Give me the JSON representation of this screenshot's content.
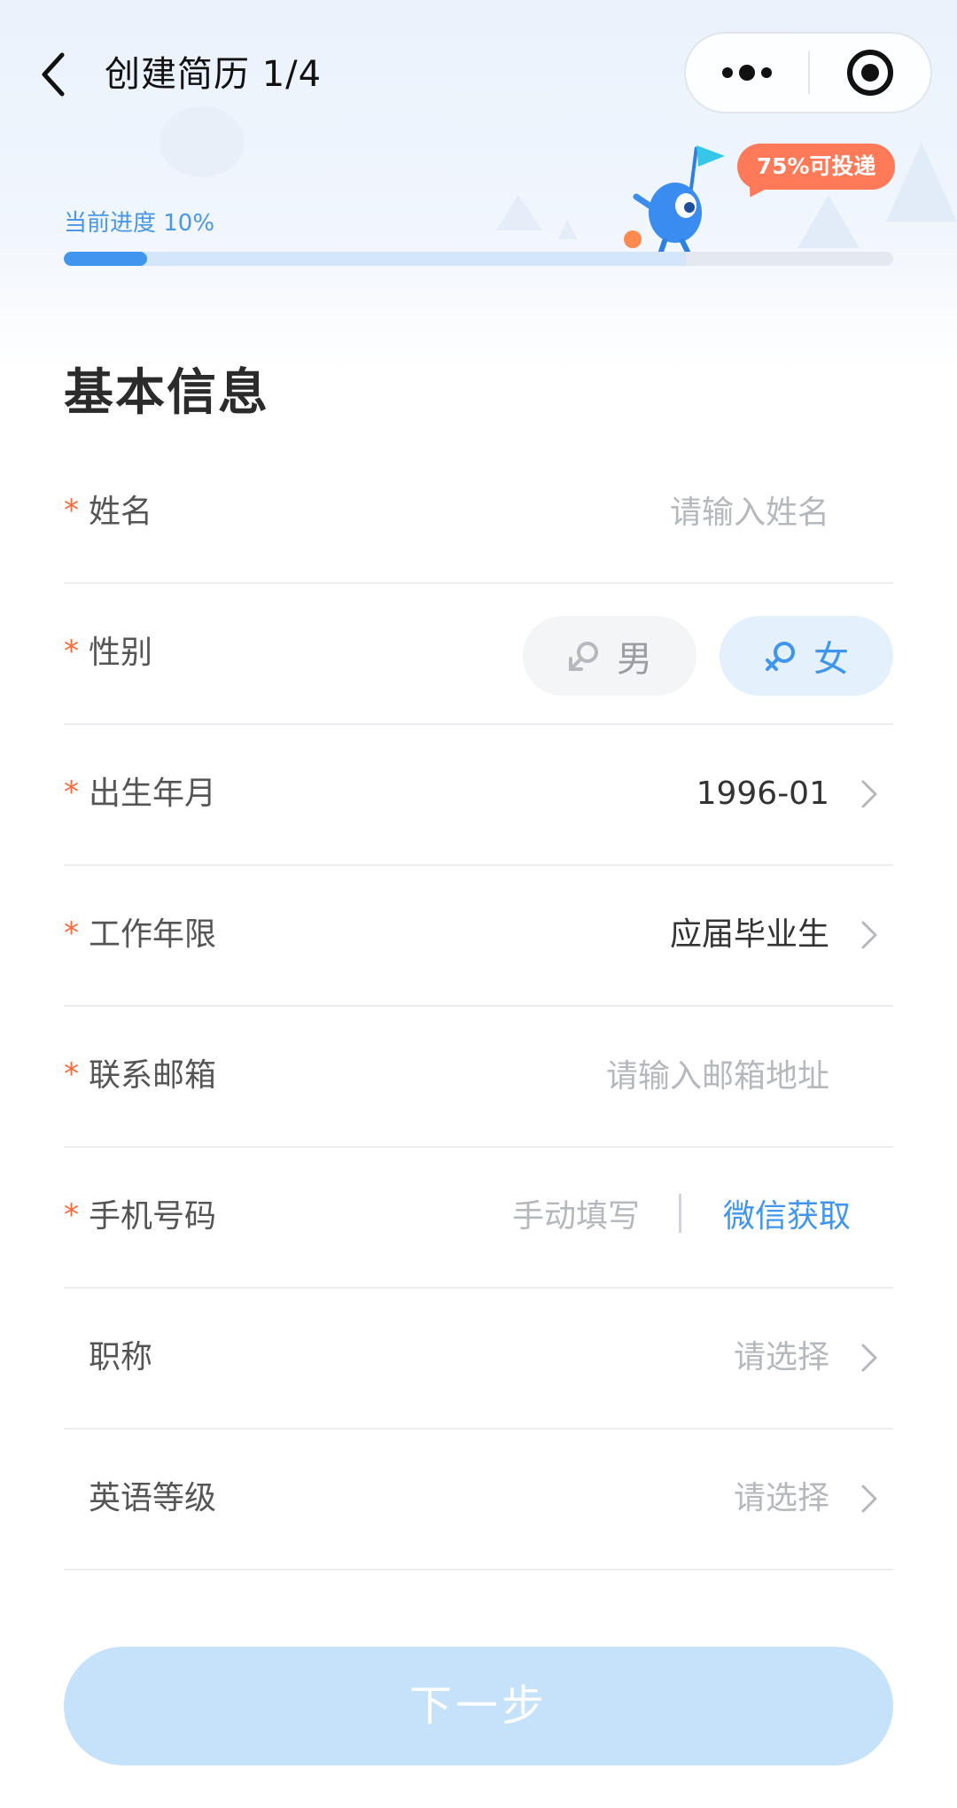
{
  "navbar": {
    "title": "创建简历 1/4",
    "back_icon": "chevron-left-icon",
    "more_icon": "more-dots-icon",
    "close_icon": "target-close-icon"
  },
  "progress": {
    "label": "当前进度 10%",
    "percent": 10,
    "deliverable_percent": 75,
    "deliverable_badge": "75%可投递",
    "colors": {
      "fill": "#3f96ec",
      "deliver": "#d3e6fa",
      "badge": "#ff7a58"
    }
  },
  "section": {
    "title": "基本信息"
  },
  "form": {
    "required_mark": "*",
    "name": {
      "label": "姓名",
      "placeholder": "请输入姓名"
    },
    "gender": {
      "label": "性别",
      "male": "男",
      "female": "女",
      "selected": "女"
    },
    "birth": {
      "label": "出生年月",
      "value": "1996-01"
    },
    "work_years": {
      "label": "工作年限",
      "value": "应届毕业生"
    },
    "email": {
      "label": "联系邮箱",
      "placeholder": "请输入邮箱地址"
    },
    "phone": {
      "label": "手机号码",
      "manual": "手动填写",
      "wechat": "微信获取"
    },
    "title": {
      "label": "职称",
      "placeholder": "请选择"
    },
    "english": {
      "label": "英语等级",
      "placeholder": "请选择"
    }
  },
  "actions": {
    "next_label": "下一步"
  },
  "accent_color": "#3f96ec",
  "required_color": "#ff6a3d"
}
